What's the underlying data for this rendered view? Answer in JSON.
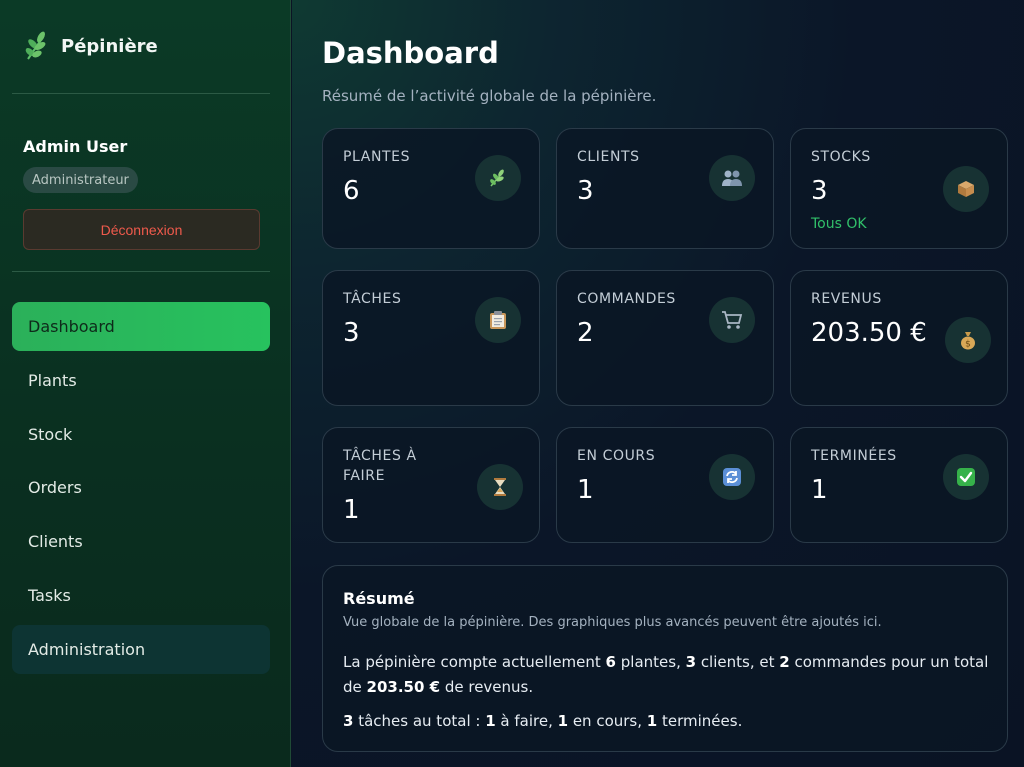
{
  "sidebar": {
    "brand": "Pépinière",
    "user_name": "Admin User",
    "role": "Administrateur",
    "logout_label": "Déconnexion",
    "nav": [
      {
        "label": "Dashboard",
        "active": true
      },
      {
        "label": "Plants"
      },
      {
        "label": "Stock"
      },
      {
        "label": "Orders"
      },
      {
        "label": "Clients"
      },
      {
        "label": "Tasks"
      },
      {
        "label": "Administration"
      }
    ]
  },
  "header": {
    "title": "Dashboard",
    "subtitle": "Résumé de l’activité globale de la pépinière."
  },
  "cards": [
    {
      "label": "PLANTES",
      "value": "6",
      "icon": "leaf-icon"
    },
    {
      "label": "CLIENTS",
      "value": "3",
      "icon": "users-icon"
    },
    {
      "label": "STOCKS",
      "value": "3",
      "note": "Tous OK",
      "icon": "box-icon"
    },
    {
      "label": "TÂCHES",
      "value": "3",
      "icon": "clipboard-icon"
    },
    {
      "label": "COMMANDES",
      "value": "2",
      "icon": "cart-icon"
    },
    {
      "label": "REVENUS",
      "value": "203.50 €",
      "icon": "money-bag-icon"
    },
    {
      "label": "TÂCHES À FAIRE",
      "value": "1",
      "icon": "hourglass-icon"
    },
    {
      "label": "EN COURS",
      "value": "1",
      "icon": "refresh-icon"
    },
    {
      "label": "TERMINÉES",
      "value": "1",
      "icon": "check-icon"
    }
  ],
  "summary": {
    "title": "Résumé",
    "subtitle": "Vue globale de la pépinière. Des graphiques plus avancés peuvent être ajoutés ici.",
    "p1": {
      "t1": "La pépinière compte actuellement ",
      "plants": "6",
      "t2": " plantes, ",
      "clients": "3",
      "t3": " clients, et ",
      "orders": "2",
      "t4": " commandes pour un total de ",
      "revenue": "203.50 €",
      "t5": " de revenus."
    },
    "p2": {
      "total": "3",
      "t1": " tâches au total : ",
      "todo": "1",
      "t2": " à faire, ",
      "inprogress": "1",
      "t3": " en cours, ",
      "done": "1",
      "t4": " terminées."
    }
  },
  "colors": {
    "accent": "#2bb05a",
    "danger": "#ef5a4c",
    "ok": "#31c06a"
  }
}
